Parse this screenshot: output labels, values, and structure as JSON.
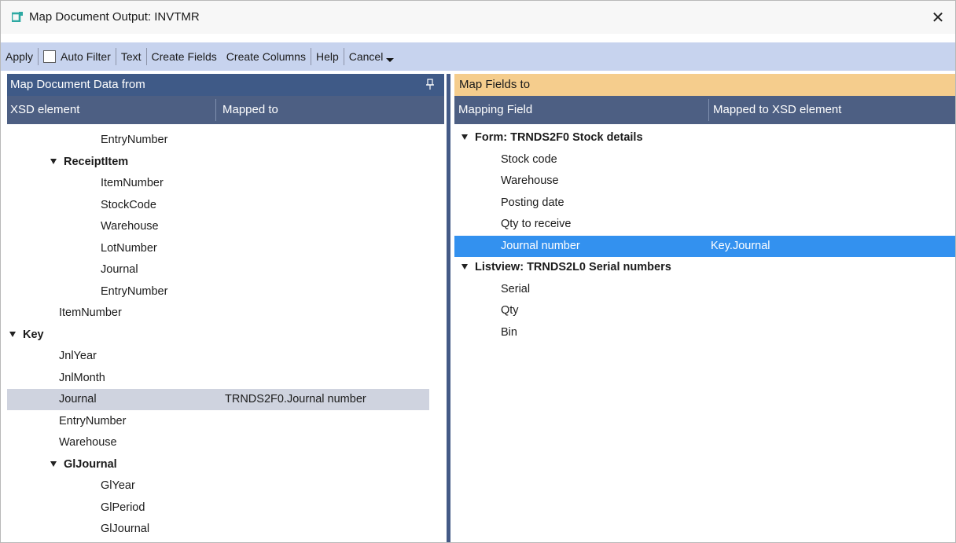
{
  "window": {
    "title": "Map Document Output: INVTMR",
    "close_glyph": "✕",
    "accent": "#2ea9a3"
  },
  "toolbar": {
    "apply": "Apply",
    "auto_filter": "Auto Filter",
    "auto_filter_checked": false,
    "text": "Text",
    "create_fields": "Create Fields",
    "create_columns": "Create Columns",
    "help": "Help",
    "cancel": "Cancel"
  },
  "left_pane": {
    "header": "Map Document Data from",
    "columns": {
      "xsd": "XSD element",
      "mapped": "Mapped to"
    },
    "rows": [
      {
        "label": "EntryNumber",
        "level": 3,
        "bold": false,
        "expander": false,
        "mapped": ""
      },
      {
        "label": "ReceiptItem",
        "level": 2,
        "bold": true,
        "expander": true,
        "mapped": ""
      },
      {
        "label": "ItemNumber",
        "level": 3,
        "bold": false,
        "expander": false,
        "mapped": ""
      },
      {
        "label": "StockCode",
        "level": 3,
        "bold": false,
        "expander": false,
        "mapped": ""
      },
      {
        "label": "Warehouse",
        "level": 3,
        "bold": false,
        "expander": false,
        "mapped": ""
      },
      {
        "label": "LotNumber",
        "level": 3,
        "bold": false,
        "expander": false,
        "mapped": ""
      },
      {
        "label": "Journal",
        "level": 3,
        "bold": false,
        "expander": false,
        "mapped": ""
      },
      {
        "label": "EntryNumber",
        "level": 3,
        "bold": false,
        "expander": false,
        "mapped": ""
      },
      {
        "label": "ItemNumber",
        "level": 2,
        "bold": false,
        "expander": false,
        "mapped": ""
      },
      {
        "label": "Key",
        "level": 1,
        "bold": true,
        "expander": true,
        "mapped": ""
      },
      {
        "label": "JnlYear",
        "level": 2,
        "bold": false,
        "expander": false,
        "mapped": ""
      },
      {
        "label": "JnlMonth",
        "level": 2,
        "bold": false,
        "expander": false,
        "mapped": ""
      },
      {
        "label": "Journal",
        "level": 2,
        "bold": false,
        "expander": false,
        "mapped": "TRNDS2F0.Journal number",
        "selected": true
      },
      {
        "label": "EntryNumber",
        "level": 2,
        "bold": false,
        "expander": false,
        "mapped": ""
      },
      {
        "label": "Warehouse",
        "level": 2,
        "bold": false,
        "expander": false,
        "mapped": ""
      },
      {
        "label": "GlJournal",
        "level": 2,
        "bold": true,
        "expander": true,
        "mapped": ""
      },
      {
        "label": "GlYear",
        "level": 3,
        "bold": false,
        "expander": false,
        "mapped": ""
      },
      {
        "label": "GlPeriod",
        "level": 3,
        "bold": false,
        "expander": false,
        "mapped": ""
      },
      {
        "label": "GlJournal",
        "level": 3,
        "bold": false,
        "expander": false,
        "mapped": ""
      }
    ]
  },
  "right_pane": {
    "header": "Map Fields to",
    "columns": {
      "field": "Mapping Field",
      "xsd": "Mapped to XSD element"
    },
    "rows": [
      {
        "label": "Form: TRNDS2F0 Stock details",
        "group": true,
        "mapped": ""
      },
      {
        "label": "Stock code",
        "group": false,
        "mapped": ""
      },
      {
        "label": "Warehouse",
        "group": false,
        "mapped": ""
      },
      {
        "label": "Posting date",
        "group": false,
        "mapped": ""
      },
      {
        "label": "Qty to receive",
        "group": false,
        "mapped": ""
      },
      {
        "label": "Journal number",
        "group": false,
        "mapped": "Key.Journal",
        "selected": true
      },
      {
        "label": "Listview: TRNDS2L0 Serial numbers",
        "group": true,
        "mapped": ""
      },
      {
        "label": "Serial",
        "group": false,
        "mapped": ""
      },
      {
        "label": "Qty",
        "group": false,
        "mapped": ""
      },
      {
        "label": "Bin",
        "group": false,
        "mapped": ""
      }
    ]
  }
}
